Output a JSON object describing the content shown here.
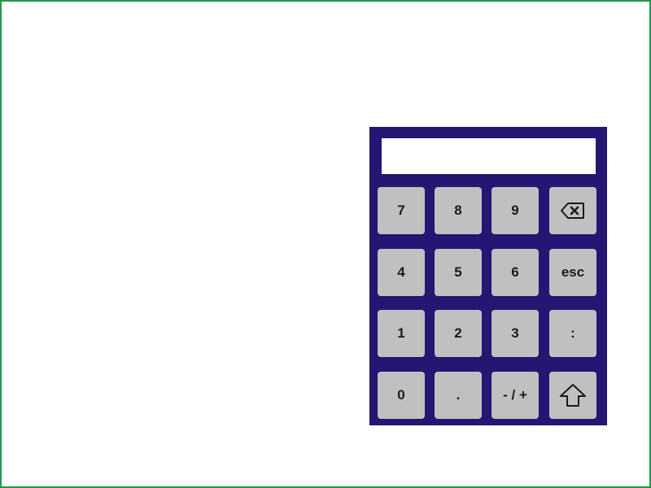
{
  "keypad": {
    "display_value": "",
    "colors": {
      "frame_border": "#1e9a4c",
      "keypad_background": "#241673",
      "key_background": "#c0c0c0",
      "display_background": "#ffffff"
    },
    "keys": {
      "k7": "7",
      "k8": "8",
      "k9": "9",
      "backspace_icon": "backspace-icon",
      "k4": "4",
      "k5": "5",
      "k6": "6",
      "esc": "esc",
      "k1": "1",
      "k2": "2",
      "k3": "3",
      "colon": ":",
      "k0": "0",
      "dot": ".",
      "sign": "- / +",
      "shift_icon": "shift-up-arrow-icon"
    }
  }
}
